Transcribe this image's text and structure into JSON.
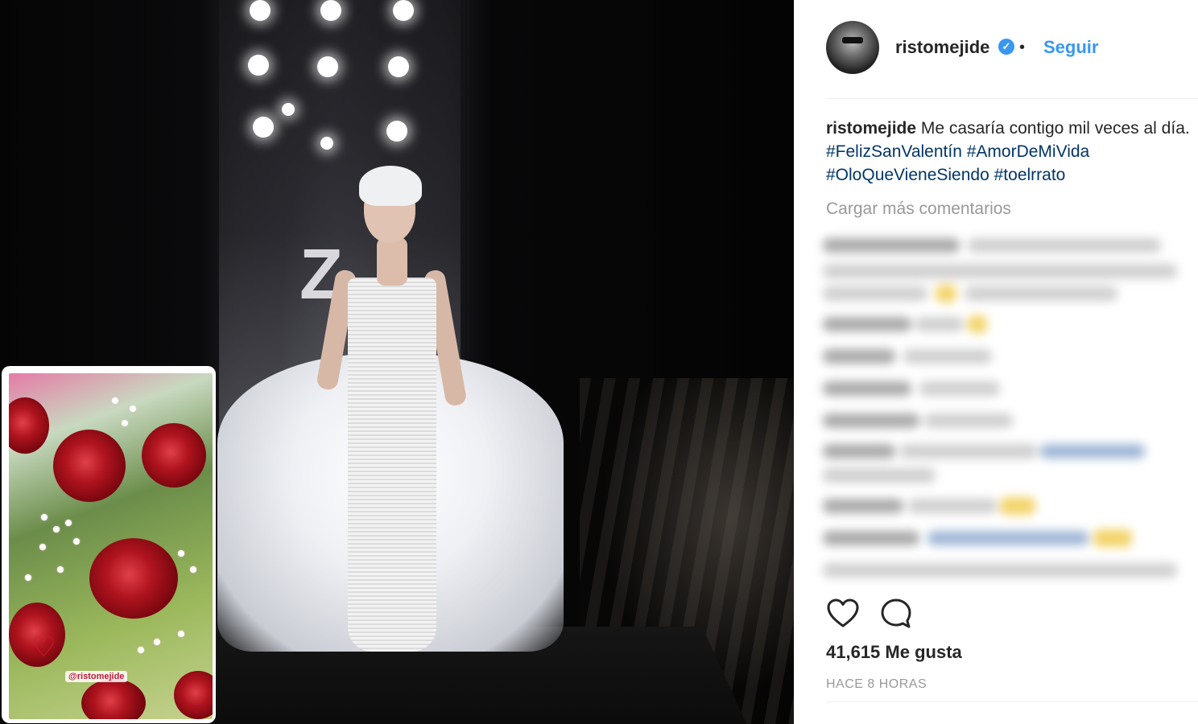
{
  "post": {
    "username": "ristomejide",
    "verified_icon": "verified-badge-icon",
    "dot": "•",
    "follow_label": "Seguir",
    "caption": {
      "user": "ristomejide",
      "text": "Me casaría contigo mil veces al día.",
      "hashtags": [
        "#FelizSanValentín",
        "#AmorDeMiVida",
        "#OloQueVieneSiendo",
        "#toelrrato"
      ]
    },
    "load_more": "Cargar más comentarios",
    "likes": "41,615 Me gusta",
    "time": "HACE 8 HORAS"
  },
  "photo": {
    "logo_text": "Z",
    "inset_mention": "@ristomejide"
  },
  "colors": {
    "accent": "#3897f0",
    "text": "#262626",
    "muted": "#999999",
    "hashtag": "#003569"
  },
  "icons": {
    "like": "heart-icon",
    "comment": "comment-icon"
  }
}
